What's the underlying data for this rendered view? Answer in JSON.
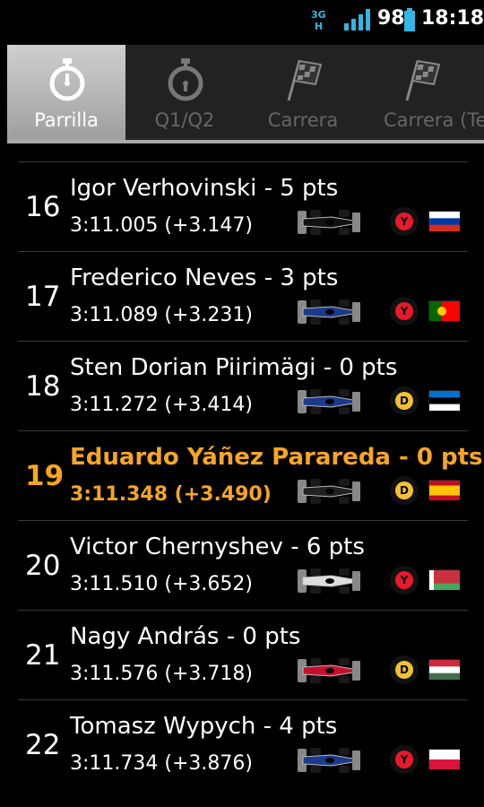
{
  "status_bar": {
    "network_icon": "data-network-icon",
    "signal_icon": "signal-strength-icon",
    "battery_percent": "98",
    "battery_icon": "battery-icon",
    "battery_color": "#33b5e5",
    "time": "18:18"
  },
  "tabs": [
    {
      "label": "Parrilla",
      "icon": "stopwatch-icon",
      "active": true
    },
    {
      "label": "Q1/Q2",
      "icon": "stopwatch-icon",
      "active": false
    },
    {
      "label": "Carrera",
      "icon": "checkered-flag-icon",
      "active": false
    },
    {
      "label": "Carrera (Tex",
      "icon": "checkered-flag-icon",
      "active": false
    }
  ],
  "rows": [
    {
      "pos": "16",
      "name": "Igor Verhovinski - 5 pts",
      "time": "3:11.005 (+3.147)",
      "tyre": "Y",
      "tyre_color": "#e8192c",
      "flag": "russia",
      "car_color": "#111111",
      "highlight": false
    },
    {
      "pos": "17",
      "name": "Frederico Neves - 3 pts",
      "time": "3:11.089 (+3.231)",
      "tyre": "Y",
      "tyre_color": "#e8192c",
      "flag": "portugal",
      "car_color": "#1b3a8c",
      "highlight": false
    },
    {
      "pos": "18",
      "name": "Sten Dorian Piirimägi - 0 pts",
      "time": "3:11.272 (+3.414)",
      "tyre": "D",
      "tyre_color": "#f2c12e",
      "flag": "estonia",
      "car_color": "#1b3a8c",
      "highlight": false
    },
    {
      "pos": "19",
      "name": "Eduardo Yáñez Parareda - 0 pts",
      "time": "3:11.348 (+3.490)",
      "tyre": "D",
      "tyre_color": "#f2c12e",
      "flag": "spain",
      "car_color": "#222222",
      "highlight": true
    },
    {
      "pos": "20",
      "name": "Victor Chernyshev - 6 pts",
      "time": "3:11.510 (+3.652)",
      "tyre": "Y",
      "tyre_color": "#e8192c",
      "flag": "belarus",
      "car_color": "#dddddd",
      "highlight": false
    },
    {
      "pos": "21",
      "name": "Nagy András - 0 pts",
      "time": "3:11.576 (+3.718)",
      "tyre": "D",
      "tyre_color": "#f2c12e",
      "flag": "hungary",
      "car_color": "#c8102e",
      "highlight": false
    },
    {
      "pos": "22",
      "name": "Tomasz Wypych - 4 pts",
      "time": "3:11.734 (+3.876)",
      "tyre": "Y",
      "tyre_color": "#e8192c",
      "flag": "poland",
      "car_color": "#1b3a8c",
      "highlight": false
    }
  ],
  "colors": {
    "highlight": "#f5a623",
    "tab_active_bg": "#bdbdbd",
    "tab_inactive_text": "#666666"
  }
}
